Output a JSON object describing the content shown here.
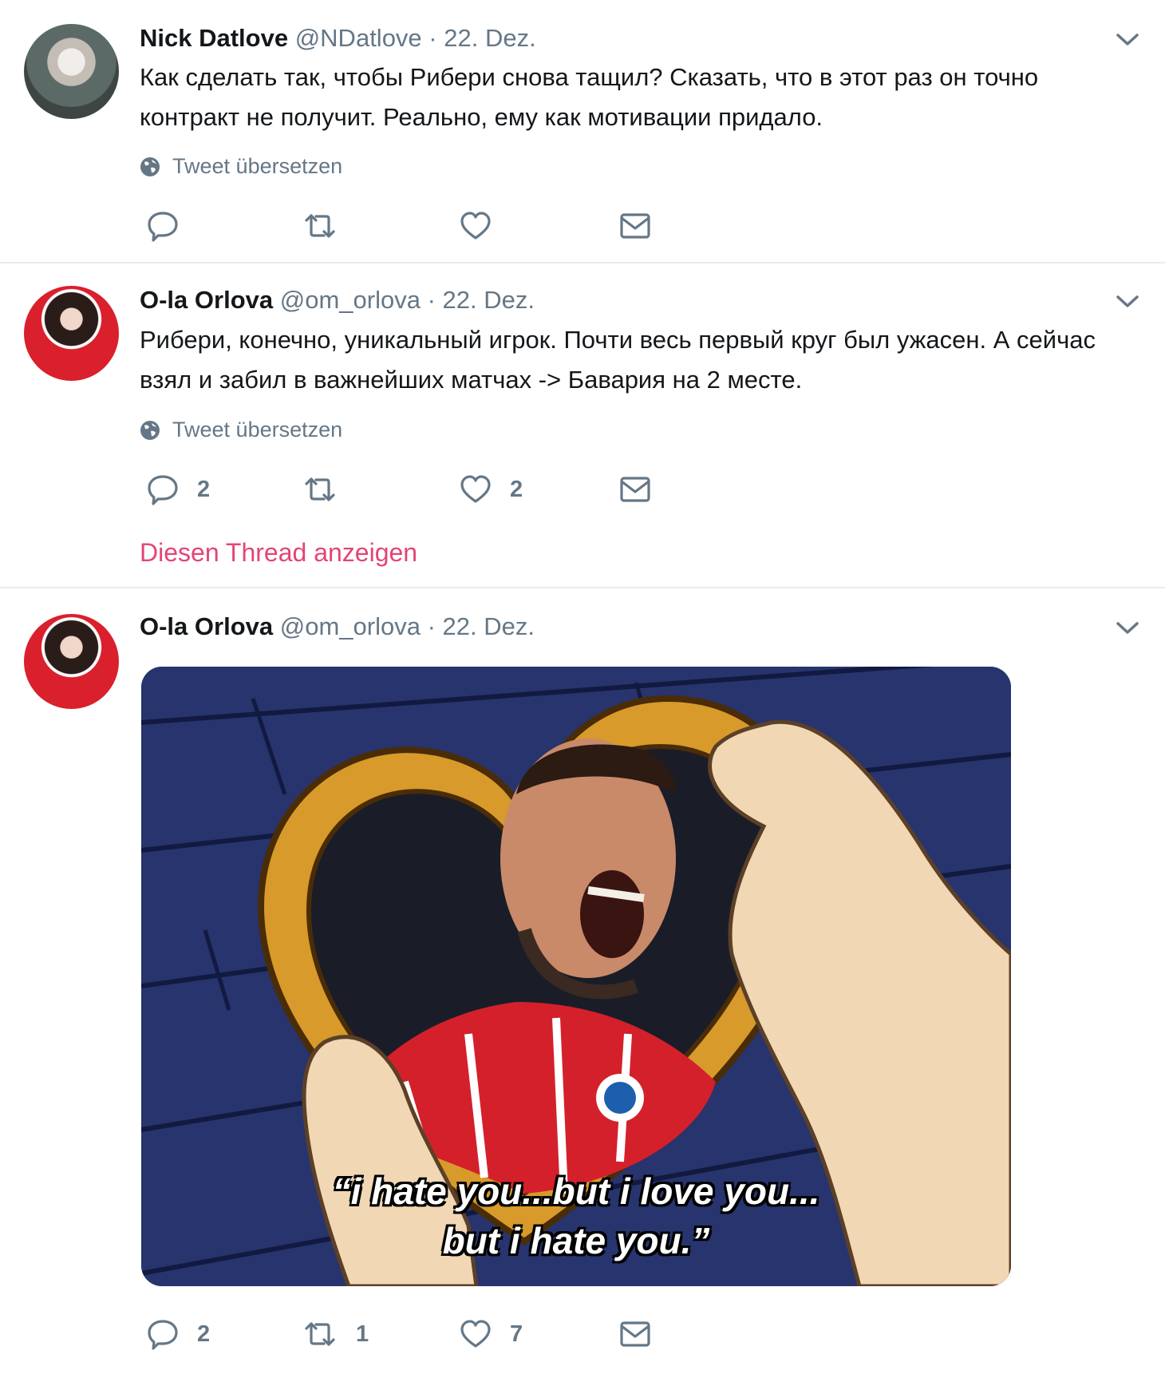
{
  "tweets": [
    {
      "name": "Nick Datlove",
      "handle": "@NDatlove",
      "separator": "·",
      "date": "22. Dez.",
      "text": "Как сделать так, чтобы Рибери снова тащил? Сказать, что в этот раз он точно контракт не получит. Реально, ему как мотивации придало.",
      "translate_label": "Tweet übersetzen",
      "replies": "",
      "retweets": "",
      "likes": ""
    },
    {
      "name": "O-la Orlova",
      "handle": "@om_orlova",
      "separator": "·",
      "date": "22. Dez.",
      "text": "Рибери, конечно, уникальный игрок. Почти весь первый круг был ужасен. А сейчас взял и забил в важнейших матчах -> Бавария на 2 месте.",
      "translate_label": "Tweet übersetzen",
      "replies": "2",
      "retweets": "",
      "likes": "2",
      "thread_link": "Diesen Thread anzeigen"
    },
    {
      "name": "O-la Orlova",
      "handle": "@om_orlova",
      "separator": "·",
      "date": "22. Dez.",
      "media_caption_line1": "“i hate you...but i love you...",
      "media_caption_line2": "but i hate you.”",
      "replies": "2",
      "retweets": "1",
      "likes": "7"
    }
  ],
  "icons": {
    "chevron": "chevron-down-icon",
    "globe": "globe-icon",
    "reply": "reply-icon",
    "retweet": "retweet-icon",
    "like": "heart-icon",
    "message": "envelope-icon"
  },
  "colors": {
    "text": "#14171a",
    "secondary": "#657786",
    "link": "#e0245e",
    "divider": "#e6ecf0",
    "media_bg": "#24336b"
  }
}
